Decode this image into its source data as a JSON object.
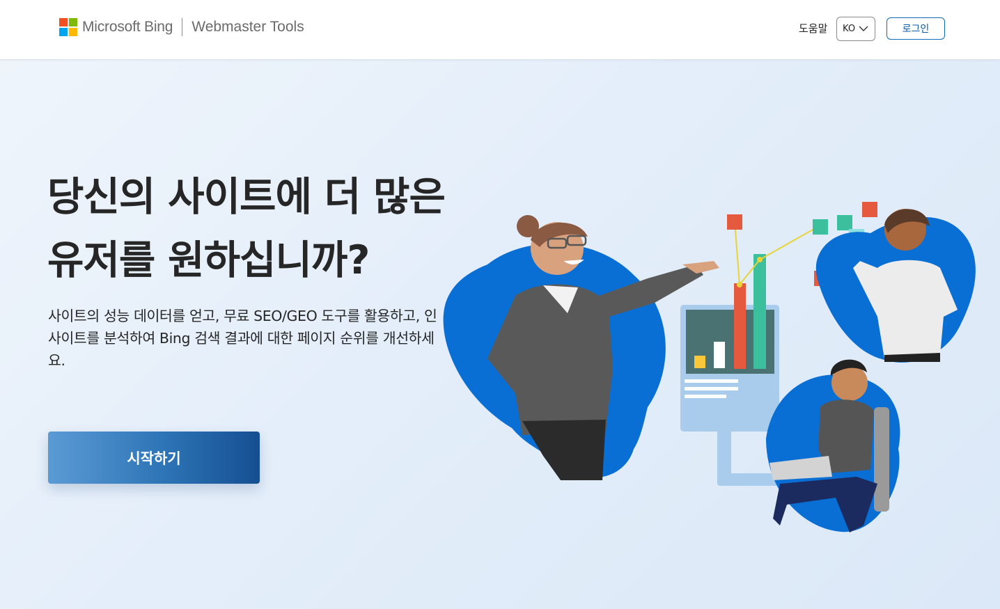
{
  "header": {
    "brand": "Microsoft Bing",
    "product": "Webmaster Tools",
    "help_label": "도움말",
    "language": "KO",
    "login_label": "로그인",
    "logo_colors": [
      "#f25022",
      "#7fba00",
      "#00a4ef",
      "#ffb900"
    ]
  },
  "hero": {
    "title": "당신의 사이트에 더 많은 유저를 원하십니까?",
    "description": "사이트의 성능 데이터를 얻고, 무료 SEO/GEO 도구를 활용하고, 인사이트를 분석하여 Bing 검색 결과에 대한 페이지 순위를 개선하세요.",
    "cta_label": "시작하기"
  },
  "colors": {
    "accent": "#0f6cbd",
    "blob_blue": "#0a6fd4",
    "cta_start": "#5b9bd5",
    "cta_end": "#154f92"
  }
}
